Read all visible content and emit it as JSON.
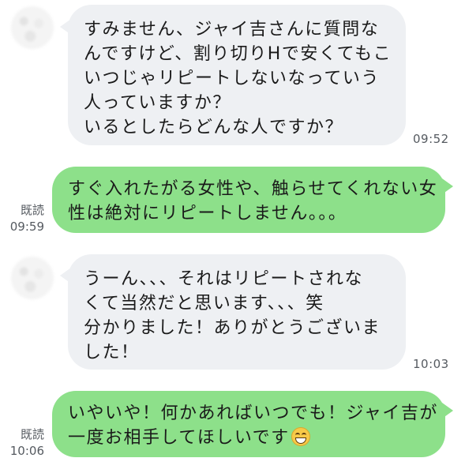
{
  "messages": [
    {
      "direction": "in",
      "lines": [
        "すみません、ジャイ吉さんに質問な",
        "んですけど、割り切りHで安くてもこ",
        "いつじゃリピートしないなっていう",
        "人っていますか？",
        "いるとしたらどんな人ですか？"
      ],
      "time": "09:52"
    },
    {
      "direction": "out",
      "lines": [
        "すぐ入れたがる女性や、触らせてくれない女",
        "性は絶対にリピートしません。。。"
      ],
      "read": "既読",
      "time": "09:59"
    },
    {
      "direction": "in",
      "lines": [
        "うーん、、、それはリピートされな",
        "くて当然だと思います、、、笑",
        "分かりました！ありがとうございま",
        "した！"
      ],
      "time": "10:03"
    },
    {
      "direction": "out",
      "lines": [
        "いやいや！何かあればいつでも！ジャイ吉が",
        "一度お相手してほしいです"
      ],
      "emoji": "grinning-face-emoji",
      "read": "既読",
      "time": "10:06"
    }
  ],
  "colors": {
    "incoming_bubble": "#eef0f3",
    "outgoing_bubble": "#8de08a",
    "meta_text": "#555a60"
  }
}
